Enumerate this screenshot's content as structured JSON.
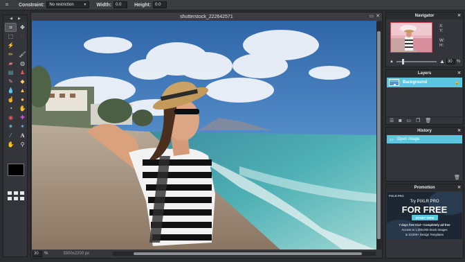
{
  "options_bar": {
    "constraint_label": "Constraint:",
    "constraint_value": "No restriction",
    "width_label": "Width:",
    "width_value": "0.0",
    "height_label": "Height:",
    "height_value": "0.0"
  },
  "document": {
    "title": "shutterstock_222642571",
    "zoom_value": "30",
    "zoom_unit": "%",
    "dimensions": "3300x2200 px"
  },
  "navigator": {
    "title": "Navigator",
    "x_label": "X:",
    "y_label": "Y:",
    "w_label": "W:",
    "h_label": "H:",
    "zoom_value": "30"
  },
  "layers": {
    "title": "Layers",
    "items": [
      {
        "name": "Background"
      }
    ]
  },
  "history": {
    "title": "History",
    "items": [
      {
        "name": "Open image"
      }
    ]
  },
  "promotion": {
    "title": "Promotion",
    "brand": "PIXLR PRO",
    "headline_small": "Try PIXLR PRO",
    "headline_big": "FOR FREE",
    "cta": "START NOW",
    "line1": "7 days free trial • Completely ad-free",
    "line2": "Access to 1,000,000 Stock Images",
    "line3": "& 10,000+ Design Templates"
  },
  "colors": {
    "accent": "#5bc6e0",
    "foreground_color": "#000000"
  }
}
